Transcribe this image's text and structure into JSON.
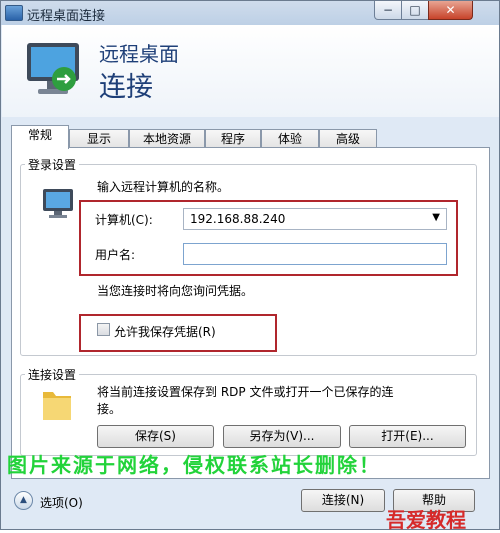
{
  "window": {
    "title": "远程桌面连接",
    "minimize_glyph": "−",
    "maximize_glyph": "□",
    "close_glyph": "✕"
  },
  "header": {
    "line1": "远程桌面",
    "line2": "连接"
  },
  "tabs": [
    {
      "label": "常规",
      "active": true
    },
    {
      "label": "显示",
      "active": false
    },
    {
      "label": "本地资源",
      "active": false
    },
    {
      "label": "程序",
      "active": false
    },
    {
      "label": "体验",
      "active": false
    },
    {
      "label": "高级",
      "active": false
    }
  ],
  "login": {
    "legend": "登录设置",
    "prompt": "输入远程计算机的名称。",
    "computer_label": "计算机(C):",
    "computer_value": "192.168.88.240",
    "username_label": "用户名:",
    "username_value": "",
    "credential_note": "当您连接时将向您询问凭据。",
    "save_credentials_label": "允许我保存凭据(R)",
    "save_credentials_checked": false
  },
  "connection": {
    "legend": "连接设置",
    "description_line1": "将当前连接设置保存到 RDP 文件或打开一个已保存的连",
    "description_line2": "接。",
    "save_button": "保存(S)",
    "save_as_button": "另存为(V)...",
    "open_button": "打开(E)..."
  },
  "watermark": "图片来源于网络，侵权联系站长删除！",
  "bottom": {
    "options_label": "选项(O)",
    "options_glyph": "▲",
    "connect_button": "连接(N)",
    "help_button": "帮助"
  },
  "logo_text": "吾爱教程",
  "colors": {
    "annotation_red": "#b0262d",
    "title_blue": "#1e3f78",
    "watermark_green": "#22d33a"
  }
}
